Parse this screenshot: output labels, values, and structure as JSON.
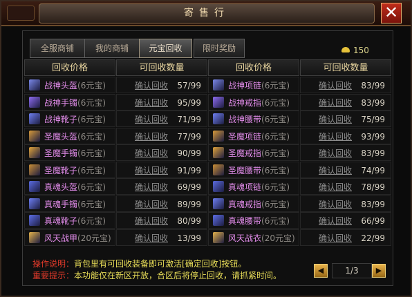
{
  "window": {
    "title": "寄售行",
    "close_icon": "close-icon"
  },
  "tabs": [
    {
      "label": "全服商铺",
      "active": false
    },
    {
      "label": "我的商铺",
      "active": false
    },
    {
      "label": "元宝回收",
      "active": true
    },
    {
      "label": "限时奖励",
      "active": false
    }
  ],
  "currency": {
    "icon": "gold-ingot-icon",
    "value": "150"
  },
  "headers": [
    "回收价格",
    "可回收数量",
    "回收价格",
    "可回收数量"
  ],
  "confirm_label": "确认回收",
  "left_items": [
    {
      "name": "战神头盔",
      "note": "(6元宝)",
      "count": "57/99"
    },
    {
      "name": "战神手镯",
      "note": "(6元宝)",
      "count": "95/99"
    },
    {
      "name": "战神靴子",
      "note": "(6元宝)",
      "count": "71/99"
    },
    {
      "name": "圣魔头盔",
      "note": "(6元宝)",
      "count": "77/99"
    },
    {
      "name": "圣魔手镯",
      "note": "(6元宝)",
      "count": "90/99"
    },
    {
      "name": "圣魔靴子",
      "note": "(6元宝)",
      "count": "91/99"
    },
    {
      "name": "真魂头盔",
      "note": "(6元宝)",
      "count": "69/99"
    },
    {
      "name": "真魂手镯",
      "note": "(6元宝)",
      "count": "89/99"
    },
    {
      "name": "真魂靴子",
      "note": "(6元宝)",
      "count": "80/99"
    },
    {
      "name": "风天战甲",
      "note": "(20元宝)",
      "count": "13/99"
    }
  ],
  "right_items": [
    {
      "name": "战神项链",
      "note": "(6元宝)",
      "count": "83/99"
    },
    {
      "name": "战神戒指",
      "note": "(6元宝)",
      "count": "83/99"
    },
    {
      "name": "战神腰带",
      "note": "(6元宝)",
      "count": "75/99"
    },
    {
      "name": "圣魔项链",
      "note": "(6元宝)",
      "count": "93/99"
    },
    {
      "name": "圣魔戒指",
      "note": "(6元宝)",
      "count": "83/99"
    },
    {
      "name": "圣魔腰带",
      "note": "(6元宝)",
      "count": "74/99"
    },
    {
      "name": "真魂项链",
      "note": "(6元宝)",
      "count": "78/99"
    },
    {
      "name": "真魂戒指",
      "note": "(6元宝)",
      "count": "83/99"
    },
    {
      "name": "真魂腰带",
      "note": "(6元宝)",
      "count": "66/99"
    },
    {
      "name": "风天战衣",
      "note": "(20元宝)",
      "count": "22/99"
    }
  ],
  "notes": {
    "operation_label": "操作说明：",
    "operation_text": "背包里有可回收装备即可激活[确定回收]按钮。",
    "important_label": "重要提示：",
    "important_text": "本功能仅在新区开放，合区后将停止回收，请抓紧时间。"
  },
  "pager": {
    "page": "1/3",
    "prev_icon": "prev-arrow-icon",
    "next_icon": "next-arrow-icon"
  }
}
